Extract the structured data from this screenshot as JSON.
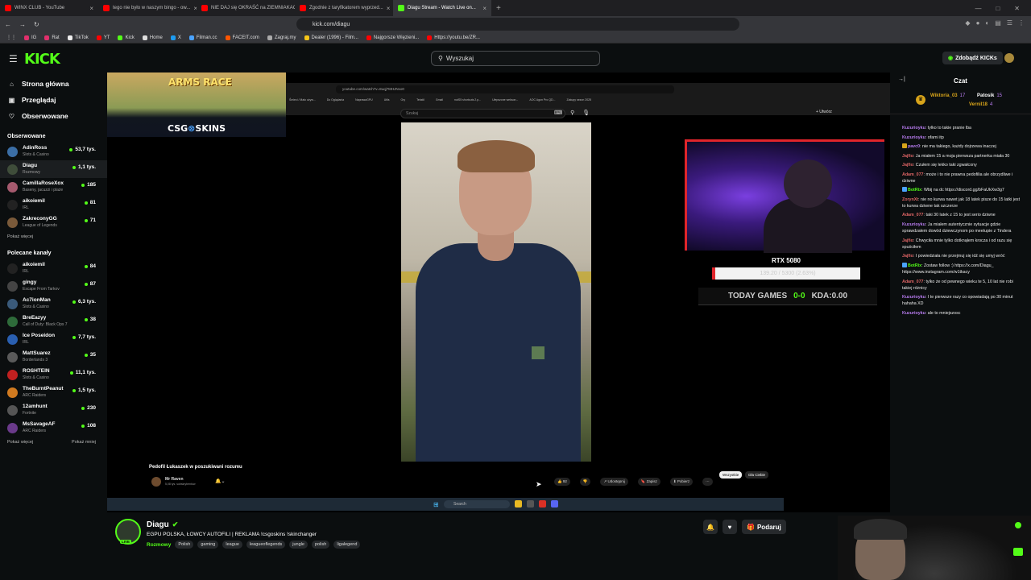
{
  "browser": {
    "tabs": [
      {
        "title": "WINX CLUB - YouTube",
        "color": "#ff0000",
        "active": false
      },
      {
        "title": "tego nie było w naszym bingo - ow...",
        "color": "#ff0000",
        "active": false
      },
      {
        "title": "NIE DAJ się OKRAŚĆ na ZIEMNIAKAC...",
        "color": "#ff0000",
        "active": false
      },
      {
        "title": "Zgodnie z taryfikatorem wyprzed...",
        "color": "#ff0000",
        "active": false
      },
      {
        "title": "Diagu Stream - Watch Live on...",
        "color": "#53fc18",
        "active": true
      }
    ],
    "url": "kick.com/diagu",
    "bookmarks": [
      {
        "label": "IG",
        "color": "#e1306c"
      },
      {
        "label": "Rat",
        "color": "#e1306c"
      },
      {
        "label": "TikTok",
        "color": "#eee"
      },
      {
        "label": "YT",
        "color": "#ff0000"
      },
      {
        "label": "Kick",
        "color": "#53fc18"
      },
      {
        "label": "Home",
        "color": "#ddd"
      },
      {
        "label": "X",
        "color": "#1d9bf0"
      },
      {
        "label": "Filman.cc",
        "color": "#4aa3ff"
      },
      {
        "label": "FACEIT.com",
        "color": "#ff5500"
      },
      {
        "label": "Zagraj.my",
        "color": "#aaa"
      },
      {
        "label": "Dealer (1996) - Film...",
        "color": "#f5c518"
      },
      {
        "label": "Najgorsze Więzieni...",
        "color": "#ff0000"
      },
      {
        "label": "Https://youtu.be/ZR...",
        "color": "#ff0000"
      }
    ]
  },
  "header": {
    "logo": "KICK",
    "search_placeholder": "Wyszukaj",
    "kicks_label": "Zdobądź KICKs"
  },
  "sidebar": {
    "nav": [
      {
        "label": "Strona główna",
        "icon": "home-icon",
        "glyph": "⌂"
      },
      {
        "label": "Przeglądaj",
        "icon": "browse-icon",
        "glyph": "▣"
      },
      {
        "label": "Obserwowane",
        "icon": "heart-icon",
        "glyph": "♡"
      }
    ],
    "followed_title": "Obserwowane",
    "followed": [
      {
        "name": "AdinRoss",
        "category": "Slots & Casino",
        "viewers": "53,7 tys.",
        "color": "#3b6ea5"
      },
      {
        "name": "Diagu",
        "category": "Rozmowy",
        "viewers": "1,1 tys.",
        "color": "#3f4d3a"
      },
      {
        "name": "CamillaRoseXox",
        "category": "Baseny, jacuzzi i plaże",
        "viewers": "185",
        "color": "#a55a6e"
      },
      {
        "name": "aikoiemil",
        "category": "IRL",
        "viewers": "81",
        "color": "#222"
      },
      {
        "name": "ZakreconyGG",
        "category": "League of Legends",
        "viewers": "71",
        "color": "#7a5a3a"
      }
    ],
    "followed_more": "Pokaż więcej",
    "recommended_title": "Polecane kanały",
    "recommended": [
      {
        "name": "aikoiemil",
        "category": "IRL",
        "viewers": "84",
        "color": "#222"
      },
      {
        "name": "gingy",
        "category": "Escape From Tarkov",
        "viewers": "87",
        "color": "#444"
      },
      {
        "name": "Ac7ionMan",
        "category": "Slots & Casino",
        "viewers": "6,3 tys.",
        "color": "#3a5a7a"
      },
      {
        "name": "BreEazyy",
        "category": "Call of Duty: Black Ops 7",
        "viewers": "38",
        "color": "#2e6b3a"
      },
      {
        "name": "Ice Poseidon",
        "category": "IRL",
        "viewers": "7,7 tys.",
        "color": "#2a5fb0"
      },
      {
        "name": "MattSuarez",
        "category": "Borderlands 3",
        "viewers": "35",
        "color": "#5a5a5a"
      },
      {
        "name": "ROSHTEIN",
        "category": "Slots & Casino",
        "viewers": "11,1 tys.",
        "color": "#c02020"
      },
      {
        "name": "TheBurntPeanut",
        "category": "ARC Raiders",
        "viewers": "1,5 tys.",
        "color": "#d07a20"
      },
      {
        "name": "12amhunt",
        "category": "Fortnite",
        "viewers": "230",
        "color": "#555"
      },
      {
        "name": "MsSavageAF",
        "category": "ARC Raiders",
        "viewers": "108",
        "color": "#6a3a8a"
      }
    ],
    "recommended_more": "Pokaż więcej",
    "recommended_less": "Pokaż mniej"
  },
  "player": {
    "ad_title": "ARMS RACE",
    "ad_sub_prefix": "CSG",
    "ad_sub_logo": "⊗",
    "ad_sub_suffix": "SKINS",
    "inner_url": "youtube.com/watch?v=8uqj7MHJNxo0",
    "inner_bookmarks": [
      "Śmieci / Mało używ...",
      "Do Oglądania",
      "NaprawaGPU",
      "Utils",
      "Gry",
      "Tekstil",
      "Gmail",
      "nutS5 shortcuts 2.p...",
      "Ulepszone wekson...",
      "AOC Agon Pro QD...",
      "Zakupy sezon 2025"
    ],
    "yt_search_placeholder": "Szukaj",
    "yt_create": "+ Utwórz",
    "video_title": "Pedofil Łukaszek w poszukiwani rozumu",
    "video_channel": "Mr Raven",
    "video_subs": "5,08 tys. subskrybentów",
    "yt_actions": [
      "👍 92",
      "👎",
      "↗ Udostępnij",
      "🔖 Zapisz",
      "⬇ Pobierz",
      "⋯"
    ],
    "yt_chips": [
      "Wszystkie",
      "Dla Ciebie"
    ],
    "taskbar_search": "Search",
    "rtx_label": "RTX 5080",
    "rtx_progress": "139.20 / 5300 (2.63%)",
    "today_games_label": "TODAY GAMES",
    "today_games_score": "0-0",
    "kda": "KDA:0.00"
  },
  "stream": {
    "name": "Diagu",
    "title": "EGPU POLSKA, ŁOWCY AUTOFILI | REKLAMA !csgoskins !skinchanger",
    "category": "Rozmowy",
    "tags": [
      "Polish",
      "gaming",
      "league",
      "leagueoflegends",
      "jungle",
      "polish",
      "ligalegend"
    ],
    "live_label": "LIVE",
    "gift_label": "Podaruj"
  },
  "chat": {
    "title": "Czat",
    "pinned": [
      {
        "name": "Wiktoria_03",
        "extra": "17",
        "color": "#d8a41a"
      },
      {
        "name": "Patosik",
        "extra": "15",
        "color": "#ffffff"
      },
      {
        "name": "Vernil18",
        "extra": "4",
        "color": "#d8a41a"
      }
    ],
    "messages": [
      {
        "user": "Kuzurioyku",
        "color": "#b87cf0",
        "badge": "",
        "text": "tylko to takie pranie lba"
      },
      {
        "user": "Kuzurioyku",
        "color": "#b87cf0",
        "badge": "",
        "text": "ofami itp"
      },
      {
        "user": "pavc0",
        "color": "#b87cf0",
        "badge": "#d8a41a",
        "text": "nie ma takiego, każdy dojrzewa inaczej"
      },
      {
        "user": "Jajfio",
        "color": "#e06666",
        "badge": "",
        "text": "Ja miałem 15 a moja pierwsza partnerka miała 30"
      },
      {
        "user": "Jajfio",
        "color": "#e06666",
        "badge": "",
        "text": "Czułem się lekko taki zgwałcony"
      },
      {
        "user": "Adam_077",
        "color": "#e06666",
        "badge": "",
        "text": "może i to nie prawna pedofilia ale obrzydliwe i dziwne"
      },
      {
        "user": "BotRix",
        "color": "#53fc18",
        "badge": "#4aa3ff",
        "text": "Wbij na dc https://discord.gg/bFaUkXw3g7"
      },
      {
        "user": "ZorynXt",
        "color": "#e06666",
        "badge": "",
        "text": "nie no kurwa nawet jak 18 latek pisze do 15 latki jest to kurwa dziwne tak szczerze"
      },
      {
        "user": "Adam_077",
        "color": "#e06666",
        "badge": "",
        "text": "taki 30 latek z 15 to jest serio dziwne"
      },
      {
        "user": "Kuzurioyku",
        "color": "#b87cf0",
        "badge": "",
        "text": "Ja miałem autentycznie sytuacje gdzie sprawdzałem dowód dziewczynom po meetupie z Tindera"
      },
      {
        "user": "Jajfio",
        "color": "#e06666",
        "badge": "",
        "text": "Chwyciła mnie tylko dotknąłem krocza i od razu się spuściłem"
      },
      {
        "user": "Jajfio",
        "color": "#e06666",
        "badge": "",
        "text": "I powiedziała nie przejmuj się idź się umyj wróć"
      },
      {
        "user": "BotRix",
        "color": "#53fc18",
        "badge": "#4aa3ff",
        "text": "Zostaw follow :) https://x.com/Diagu_ https://www.instagram.com/w1tkacy"
      },
      {
        "user": "Adam_077",
        "color": "#e06666",
        "badge": "",
        "text": "tylko że od pewnego wieku te 5, 10 lat nie robi takiej różnicy"
      },
      {
        "user": "Kuzurioyku",
        "color": "#b87cf0",
        "badge": "",
        "text": "I te pierwsze razy co opowiadają po 30 minut hahaha XD"
      },
      {
        "user": "Kuzurioyku",
        "color": "#b87cf0",
        "badge": "",
        "text": "ale to mniejszosc"
      }
    ]
  }
}
